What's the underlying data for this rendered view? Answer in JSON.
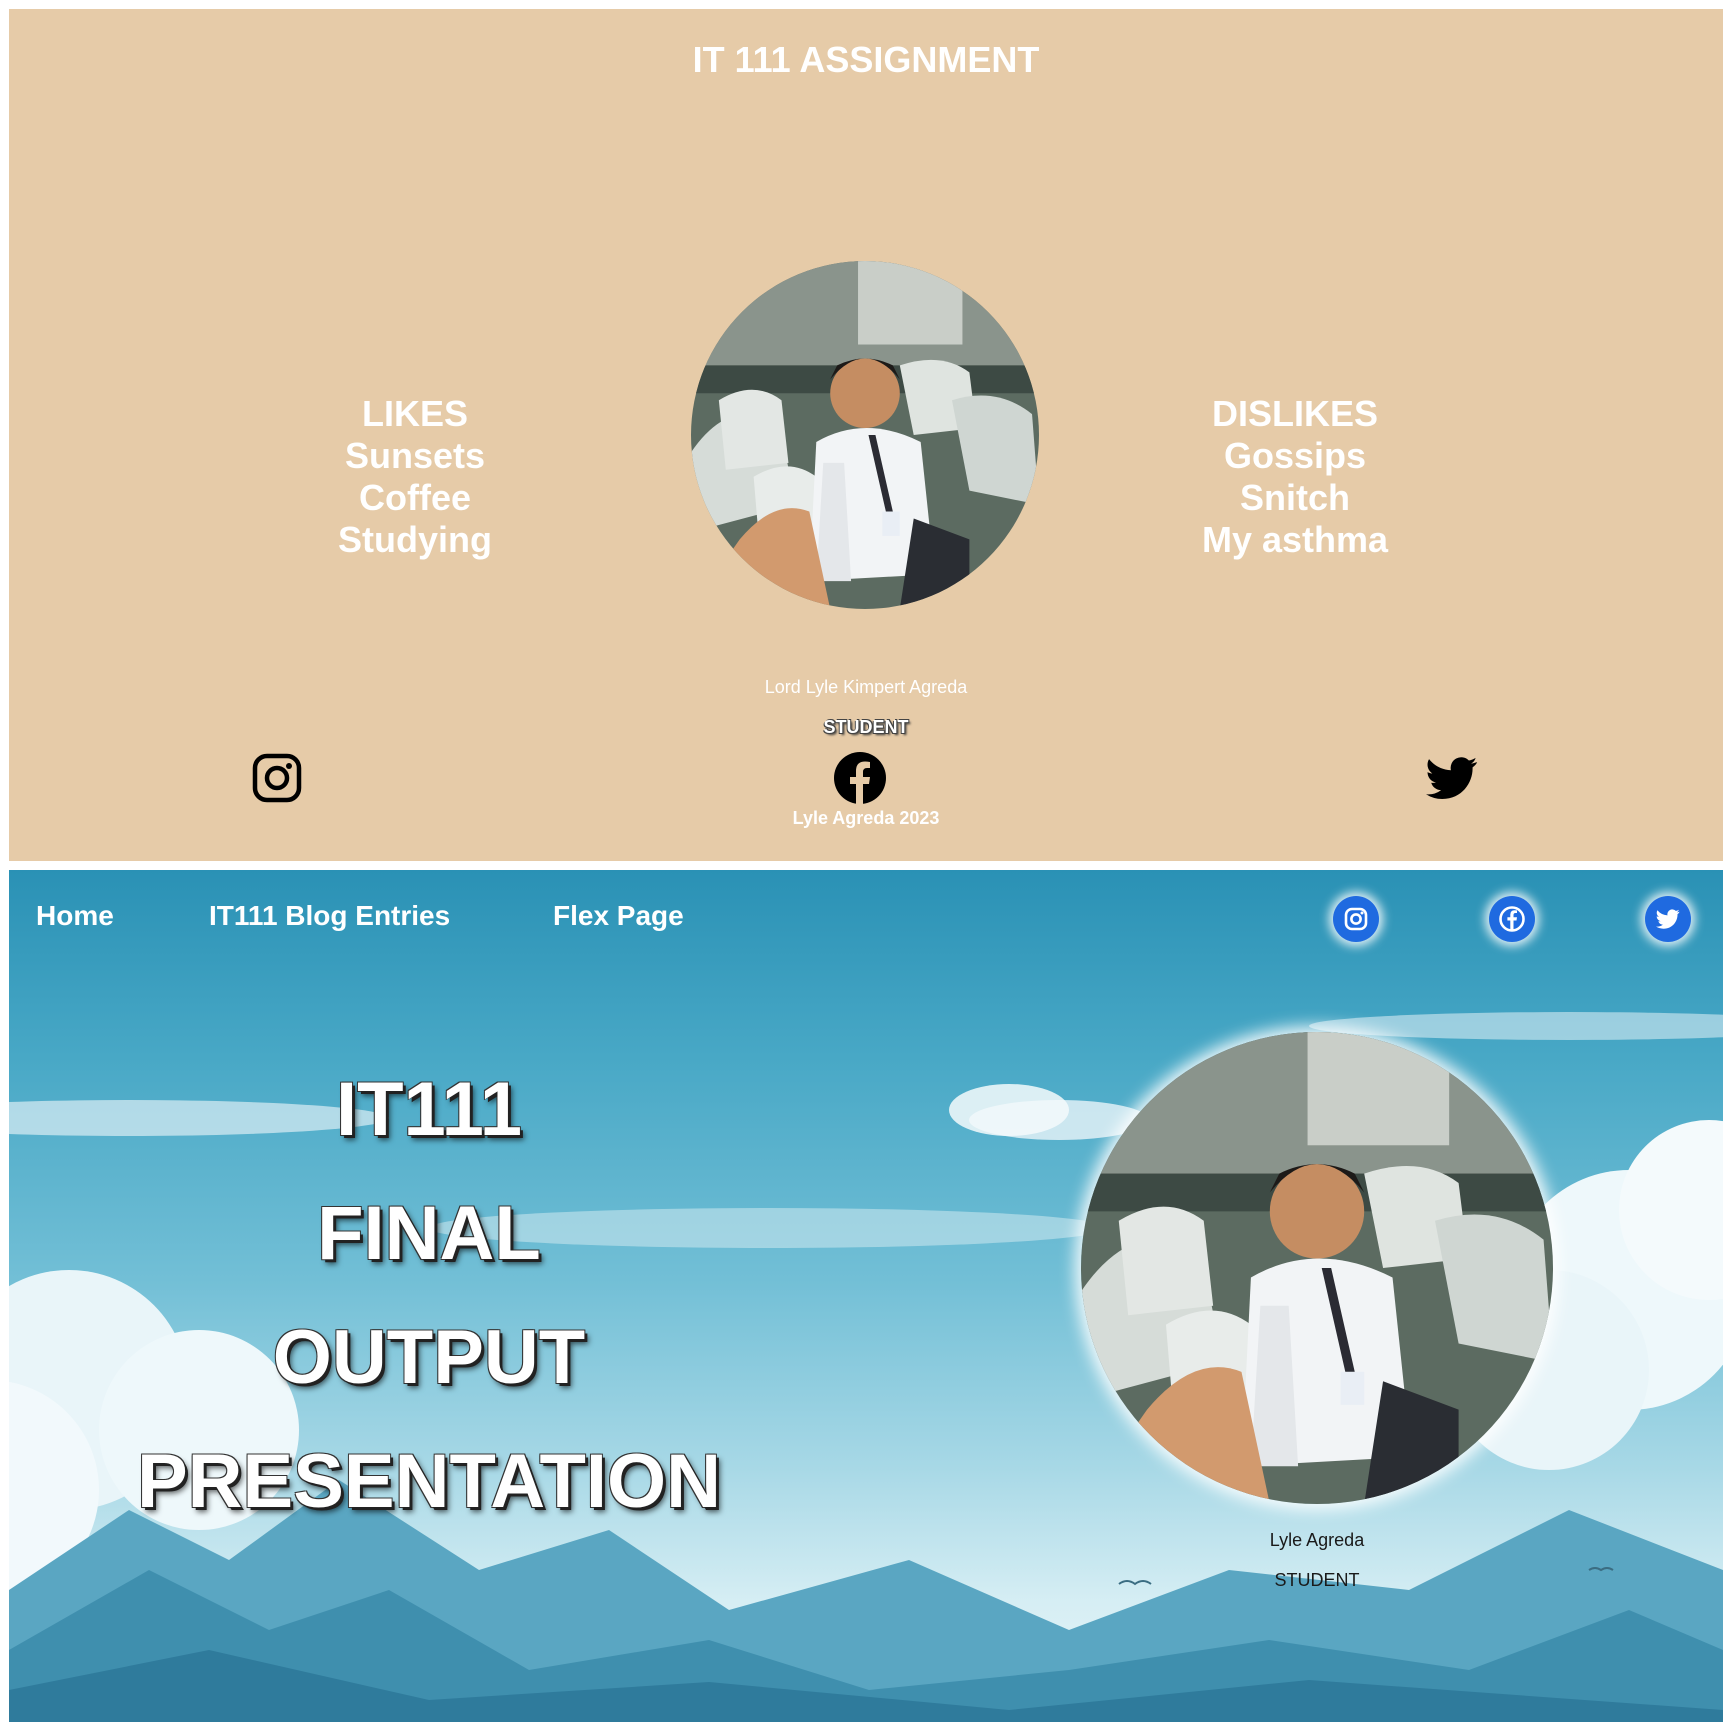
{
  "assignment_page": {
    "title": "IT 111 ASSIGNMENT",
    "likes": [
      "LIKES",
      "Sunsets",
      "Coffee",
      "Studying"
    ],
    "dislikes": [
      "DISLIKES",
      "Gossips",
      "Snitch",
      "My asthma"
    ],
    "profile_photo": "profile-photo",
    "name": "Lord Lyle Kimpert Agreda",
    "role": "STUDENT",
    "social_icons": [
      "instagram-icon",
      "facebook-icon",
      "twitter-icon"
    ],
    "footer": "Lyle Agreda 2023",
    "colors": {
      "background": "#e6cba8",
      "text": "#ffffff",
      "icons": "#000000"
    }
  },
  "final_page": {
    "nav": [
      "Home",
      "IT111 Blog Entries",
      "Flex Page"
    ],
    "social_icons": [
      "instagram-icon",
      "facebook-icon",
      "twitter-icon"
    ],
    "hero_lines": [
      "IT111",
      "FINAL",
      "OUTPUT",
      "PRESENTATION"
    ],
    "profile_photo": "profile-photo",
    "name": "Lyle Agreda",
    "role": "STUDENT",
    "colors": {
      "sky_top": "#2a91b5",
      "sky_bottom": "#e9f6f9",
      "icon_bubble": "#1f6ae0",
      "nav_text": "#ffffff"
    }
  }
}
